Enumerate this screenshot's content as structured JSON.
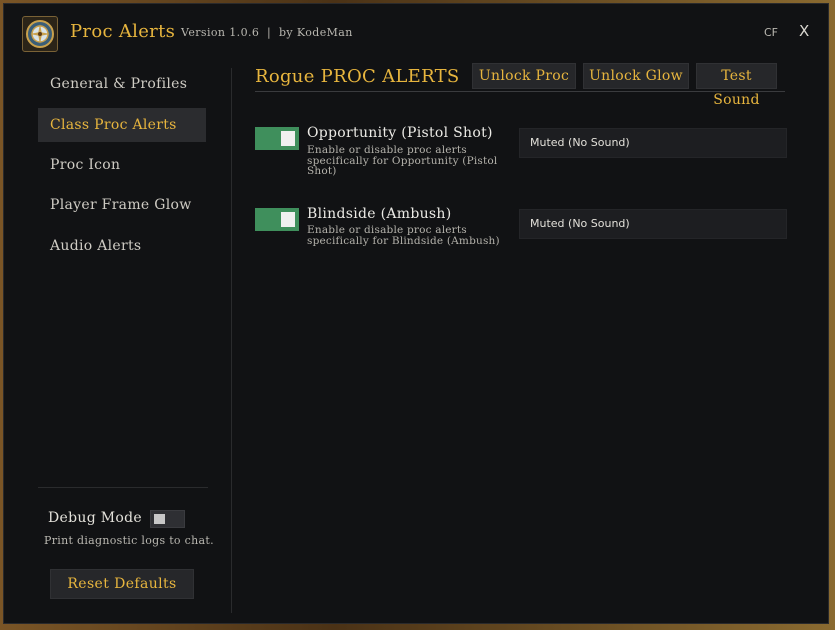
{
  "header": {
    "title": "Proc Alerts",
    "version": "Version 1.0.6  |  by KodeMan",
    "cf_label": "CF",
    "close_label": "X",
    "logo_icon": "compass-emblem-icon"
  },
  "sidebar": {
    "items": [
      {
        "label": "General & Profiles",
        "active": false
      },
      {
        "label": "Class Proc Alerts",
        "active": true
      },
      {
        "label": "Proc Icon",
        "active": false
      },
      {
        "label": "Player Frame Glow",
        "active": false
      },
      {
        "label": "Audio Alerts",
        "active": false
      }
    ],
    "debug": {
      "label": "Debug Mode",
      "enabled": false,
      "description": "Print diagnostic logs to chat."
    },
    "reset_label": "Reset Defaults"
  },
  "main": {
    "title": "Rogue PROC ALERTS",
    "buttons": {
      "unlock_proc": "Unlock Proc",
      "unlock_glow": "Unlock Glow",
      "test_sound": "Test Sound"
    },
    "procs": [
      {
        "name": "Opportunity (Pistol Shot)",
        "enabled": true,
        "description": "Enable or disable proc alerts specifically for Opportunity (Pistol Shot)",
        "sound": "Muted (No Sound)"
      },
      {
        "name": "Blindside (Ambush)",
        "enabled": true,
        "description": "Enable or disable proc alerts specifically for Blindside (Ambush)",
        "sound": "Muted (No Sound)"
      }
    ]
  },
  "colors": {
    "accent": "#e7b53e",
    "toggle_on": "#3f8f5c",
    "background": "#111214"
  }
}
